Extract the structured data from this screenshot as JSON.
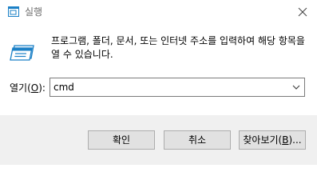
{
  "window": {
    "title": "실행",
    "title_icon": "run-app-icon",
    "close_icon": "close-icon"
  },
  "body": {
    "icon": "run-dialog-icon",
    "description": "프로그램, 폴더, 문서, 또는 인터넷 주소를 입력하여 해당 항목을 열 수 있습니다."
  },
  "open_field": {
    "label_prefix": "열기(",
    "label_accel": "O",
    "label_suffix": "):",
    "value": "cmd",
    "dropdown_icon": "chevron-down-icon"
  },
  "buttons": {
    "ok": "확인",
    "cancel": "취소",
    "browse_prefix": "찾아보기(",
    "browse_accel": "B",
    "browse_suffix": ")..."
  },
  "colors": {
    "accent_blue": "#1b80c6",
    "footer_bg": "#f0f0f0",
    "button_bg": "#e1e1e1",
    "button_border": "#adadad",
    "title_text": "#6d6d6d"
  }
}
